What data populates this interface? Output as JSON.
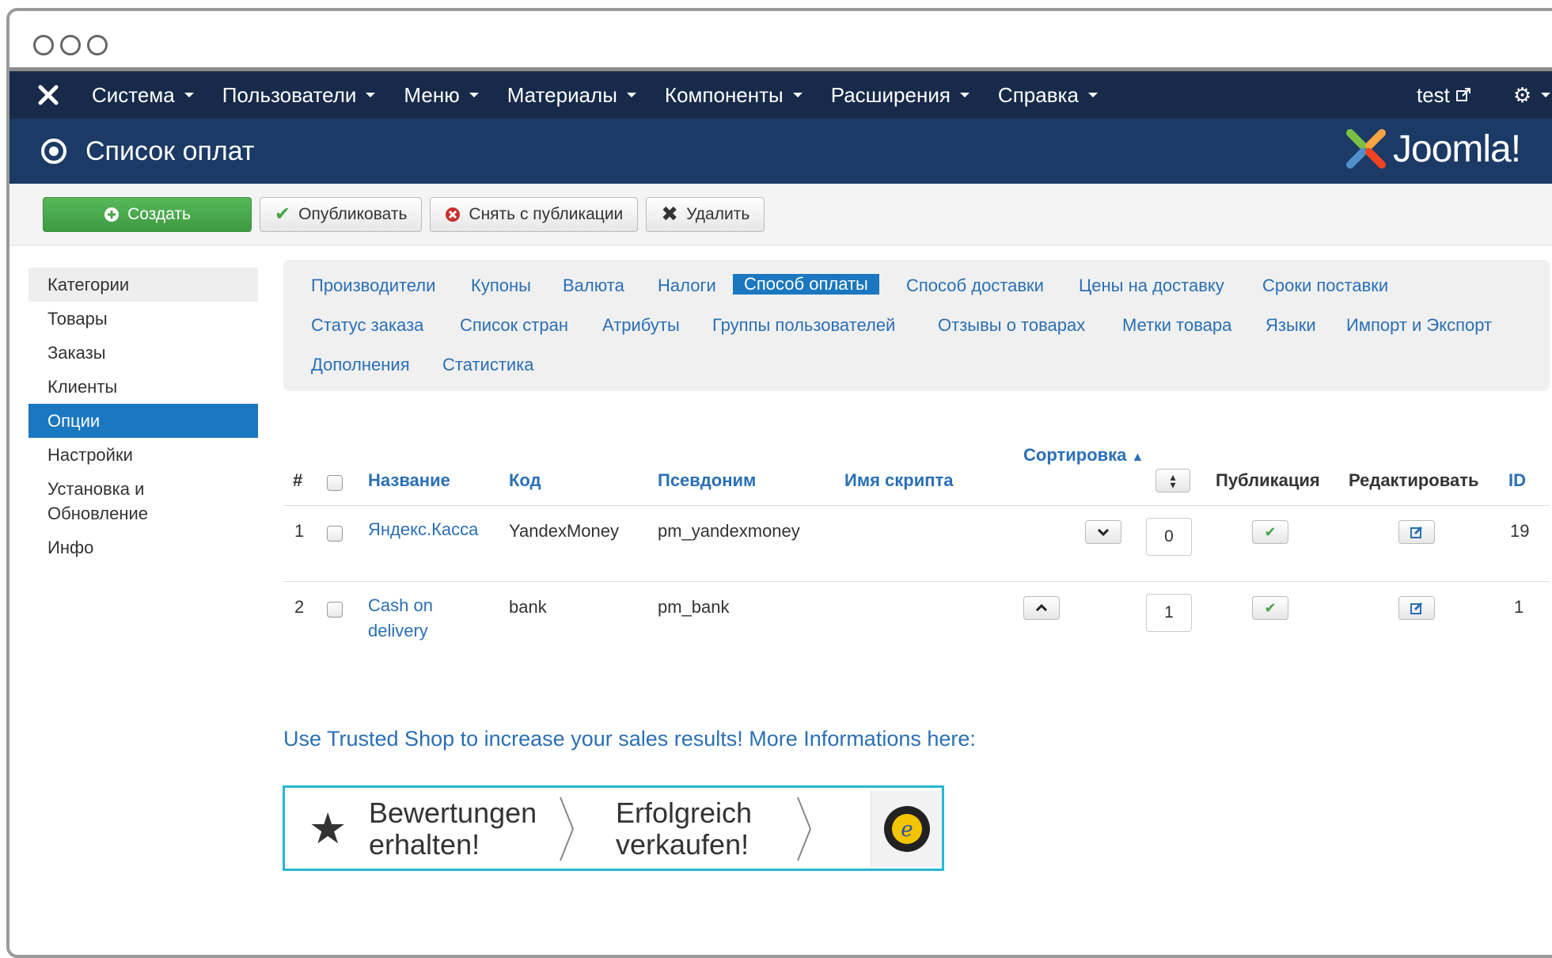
{
  "navbar": {
    "items": [
      "Система",
      "Пользователи",
      "Меню",
      "Материалы",
      "Компоненты",
      "Расширения",
      "Справка"
    ],
    "user": "test"
  },
  "header": {
    "title": "Список оплат",
    "brand": "Joomla!"
  },
  "toolbar": {
    "create": "Создать",
    "publish": "Опубликовать",
    "unpublish": "Снять с публикации",
    "delete": "Удалить"
  },
  "sidebar": {
    "items": [
      "Категории",
      "Товары",
      "Заказы",
      "Клиенты",
      "Опции",
      "Настройки",
      "Установка и Обновление",
      "Инфо"
    ],
    "active": "Опции"
  },
  "tabs": {
    "row1": [
      "Производители",
      "Купоны",
      "Валюта",
      "Налоги",
      "Способ оплаты",
      "Способ доставки",
      "Цены на доставку",
      "Сроки поставки"
    ],
    "row2": [
      "Статус заказа",
      "Список стран",
      "Атрибуты",
      "Группы пользователей",
      "Отзывы о товарах",
      "Метки товара",
      "Языки",
      "Импорт и Экспорт"
    ],
    "row3": [
      "Дополнения",
      "Статистика"
    ],
    "active": "Способ оплаты"
  },
  "table": {
    "columns": {
      "num": "#",
      "name": "Название",
      "code": "Код",
      "alias": "Псевдоним",
      "script": "Имя скрипта",
      "sort": "Сортировка",
      "publish": "Публикация",
      "edit": "Редактировать",
      "id": "ID"
    },
    "rows": [
      {
        "num": "1",
        "name": "Яндекс.Касса",
        "code": "YandexMoney",
        "alias": "pm_yandexmoney",
        "script": "",
        "order": "0",
        "id": "19"
      },
      {
        "num": "2",
        "name": "Cash on delivery",
        "code": "bank",
        "alias": "pm_bank",
        "script": "",
        "order": "1",
        "id": "1"
      }
    ]
  },
  "promo": {
    "text": "Use Trusted Shop to increase your sales results! More Informations here:",
    "banner_left": "Bewertungen erhalten!",
    "banner_right": "Erfolgreich verkaufen!"
  },
  "colors": {
    "navbar": "#172a4a",
    "header": "#1b3a65",
    "accent": "#1a77c0",
    "success": "#46a546",
    "link": "#2a6fb5",
    "banner_border": "#29b6d1"
  }
}
